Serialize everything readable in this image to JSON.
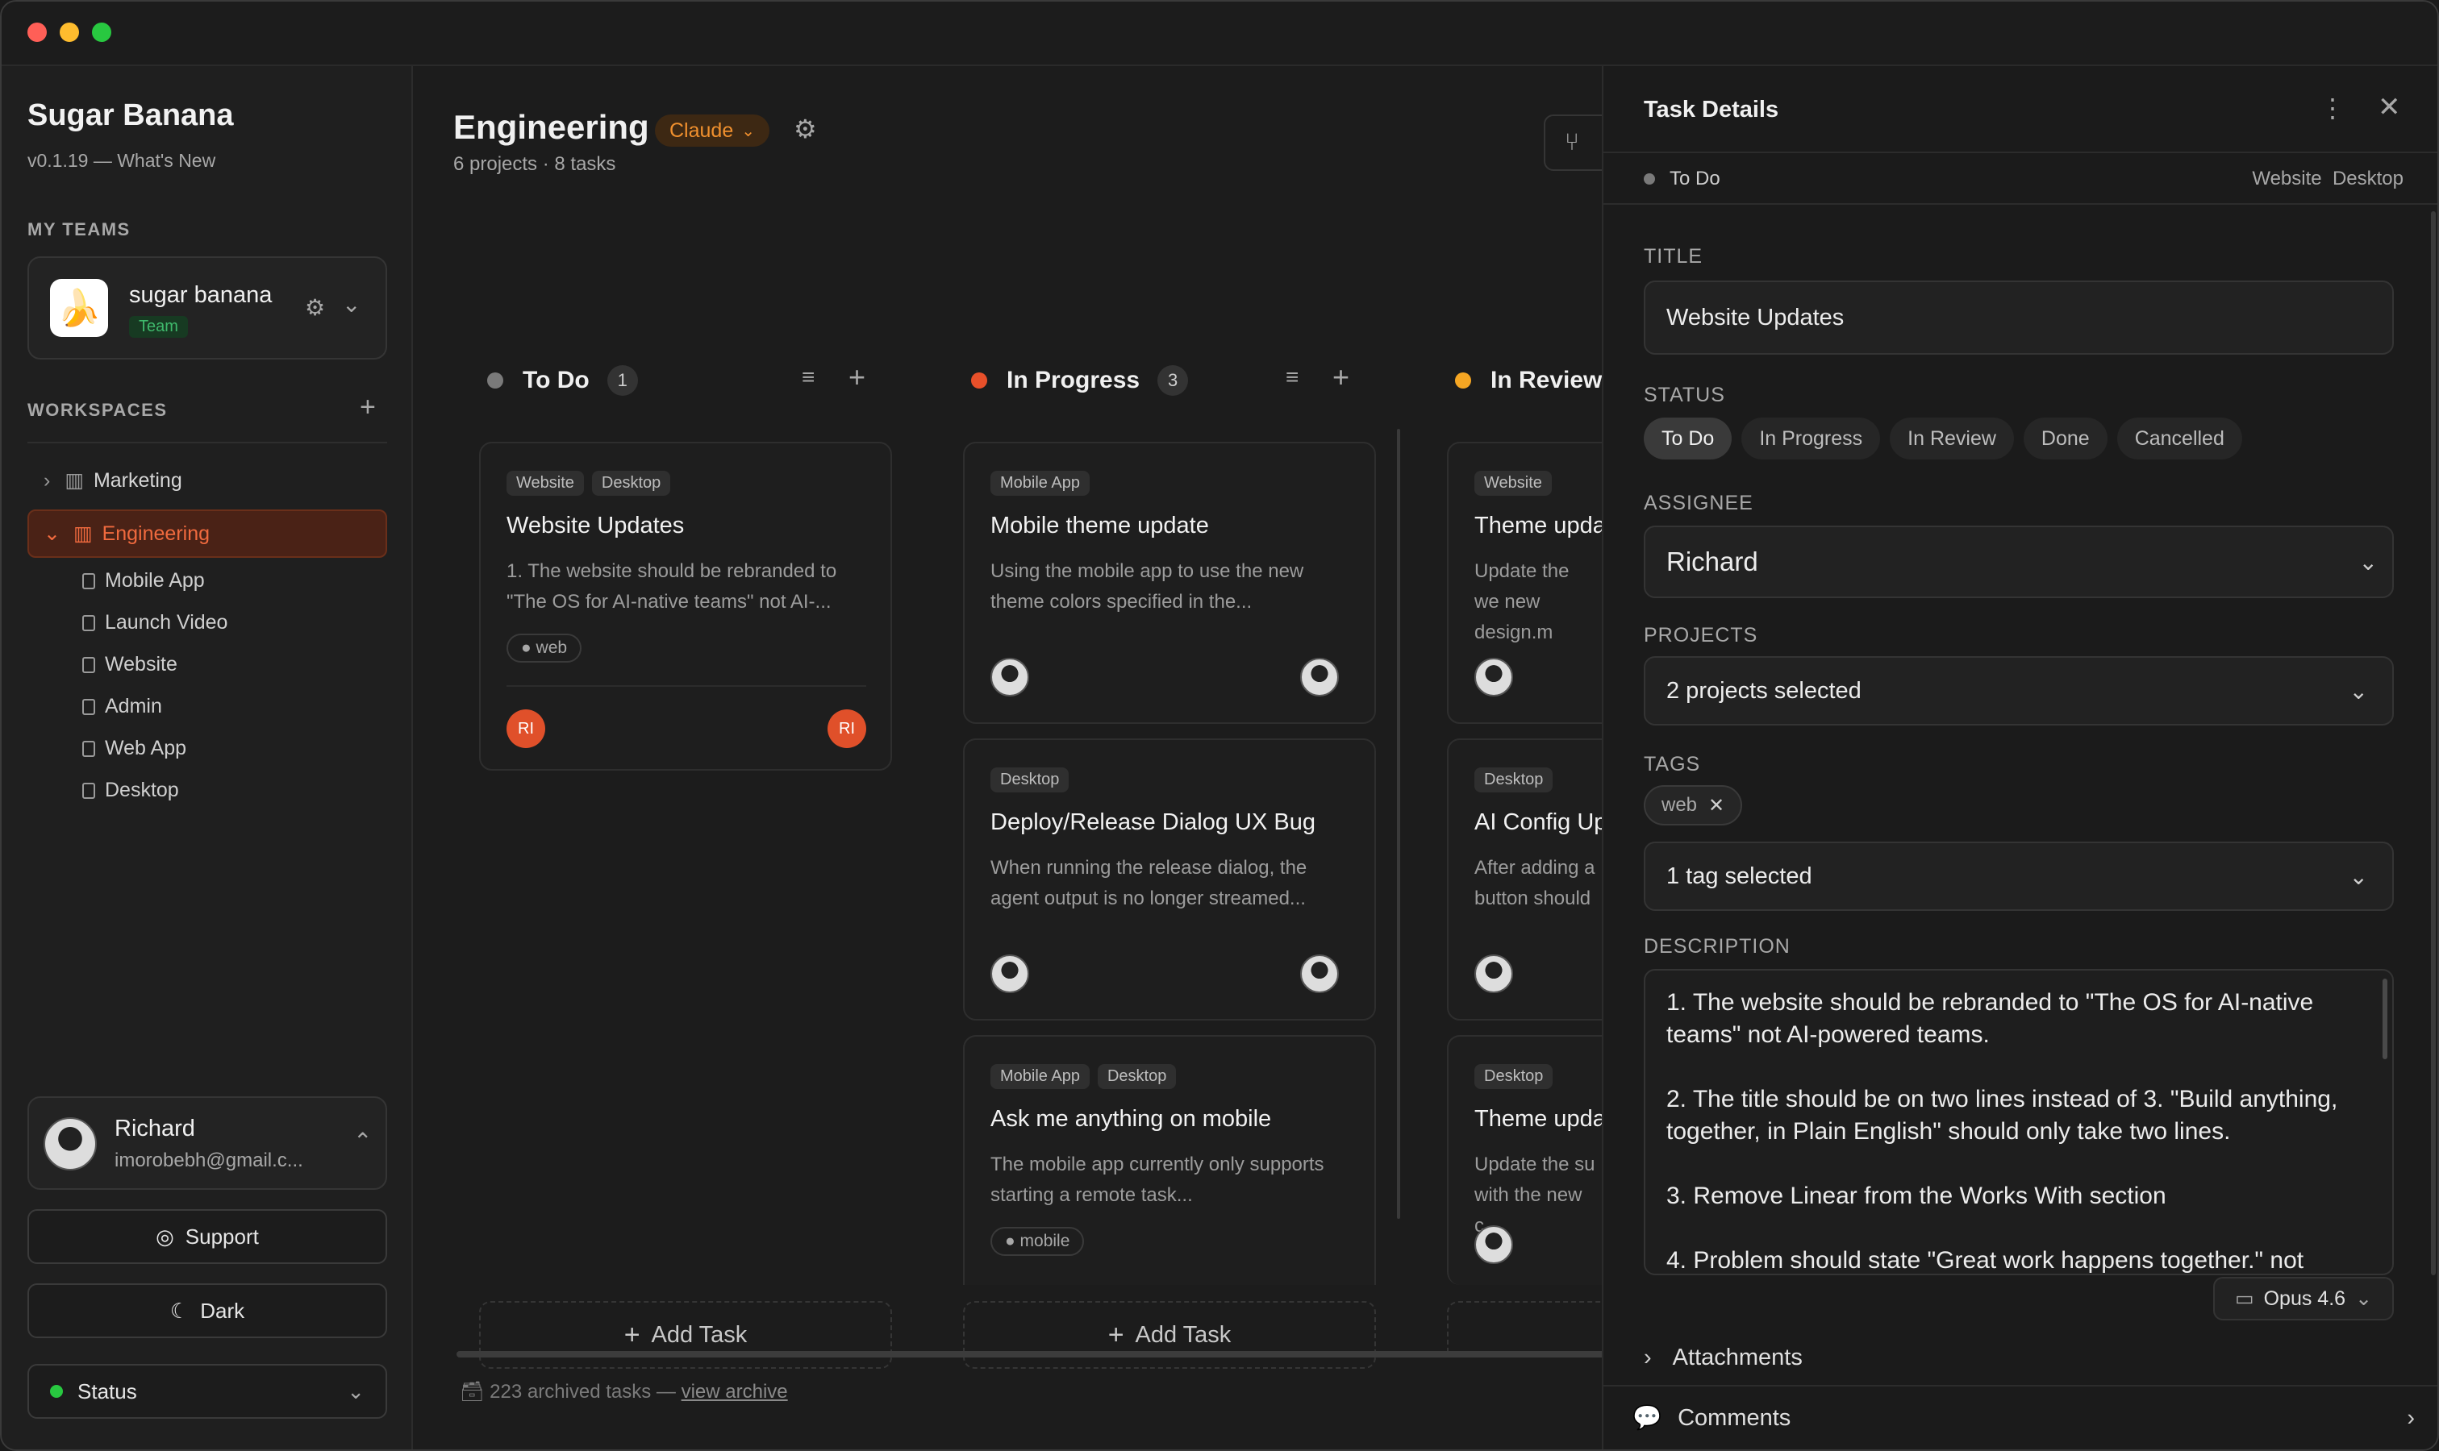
{
  "window": {
    "traffic_lights": [
      "#ff5f57",
      "#febc2e",
      "#28c840"
    ]
  },
  "sidebar": {
    "app_title": "Sugar Banana",
    "version": "v0.1.19 — What's New",
    "my_teams_label": "MY TEAMS",
    "team": {
      "name": "sugar banana",
      "badge": "Team",
      "logo": "🍌"
    },
    "workspaces_label": "WORKSPACES",
    "workspaces": [
      {
        "label": "Marketing",
        "expanded": false
      },
      {
        "label": "Engineering",
        "expanded": true,
        "active": true
      }
    ],
    "projects": [
      "Mobile App",
      "Launch Video",
      "Website",
      "Admin",
      "Web App",
      "Desktop"
    ],
    "user": {
      "name": "Richard",
      "email": "imorobebh@gmail.c..."
    },
    "support_label": "Support",
    "theme_label": "Dark",
    "status_label": "Status"
  },
  "main": {
    "title": "Engineering",
    "model_badge": "Claude",
    "counts": "6 projects · 8 tasks",
    "archive_text": "223 archived tasks —",
    "archive_link": "view archive",
    "add_task_label": "Add Task",
    "columns": [
      {
        "title": "To Do",
        "count": "1",
        "color": "#7a7a7a",
        "cards": [
          {
            "tags": [
              "Website",
              "Desktop"
            ],
            "title": "Website Updates",
            "desc": "1. The website should be rebranded to \"The OS for AI-native teams\" not AI-...",
            "chip": "web",
            "avatar_l": "RI",
            "avatar_r": "RI"
          }
        ]
      },
      {
        "title": "In Progress",
        "count": "3",
        "color": "#e8502a",
        "cards": [
          {
            "tags": [
              "Mobile App"
            ],
            "title": "Mobile theme update",
            "desc": "Using the mobile app to use the new theme colors specified in the..."
          },
          {
            "tags": [
              "Desktop"
            ],
            "title": "Deploy/Release Dialog UX Bug",
            "desc": "When running the release dialog, the agent output is no longer streamed..."
          },
          {
            "tags": [
              "Mobile App",
              "Desktop"
            ],
            "title": "Ask me anything on mobile",
            "desc": "The mobile app currently only supports starting a remote task...",
            "chip": "mobile"
          }
        ]
      },
      {
        "title": "In Review",
        "count": "",
        "color": "#f5a623",
        "cards": [
          {
            "tags": [
              "Website"
            ],
            "title": "Theme upda",
            "desc": "Update the we new design.m"
          },
          {
            "tags": [
              "Desktop"
            ],
            "title": "AI Config Up",
            "desc": "After adding a button should"
          },
          {
            "tags": [
              "Desktop"
            ],
            "title": "Theme upda",
            "desc": "Update the su with the new c"
          }
        ]
      }
    ]
  },
  "panel": {
    "header": "Task Details",
    "status_line": "To Do",
    "project_tags": "Website  Desktop",
    "title_label": "TITLE",
    "title_value": "Website Updates",
    "status_label": "STATUS",
    "statuses": [
      "To Do",
      "In Progress",
      "In Review",
      "Done",
      "Cancelled"
    ],
    "assignee_label": "ASSIGNEE",
    "assignee_value": "Richard",
    "projects_label": "PROJECTS",
    "projects_value": "2 projects selected",
    "tags_label": "TAGS",
    "tag_chip": "web",
    "tags_value": "1 tag selected",
    "description_label": "DESCRIPTION",
    "description": [
      "1. The website should be rebranded to \"The OS for AI-native teams\" not AI-powered teams.",
      "2. The title should be on two lines instead of 3.  \"Build anything, together, in Plain English\" should only take two lines.",
      "3. Remove Linear from the Works With section",
      "4. Problem should state \"Great work happens together.\" not"
    ],
    "model": "Opus 4.6",
    "attachments_label": "Attachments",
    "comments_label": "Comments"
  }
}
